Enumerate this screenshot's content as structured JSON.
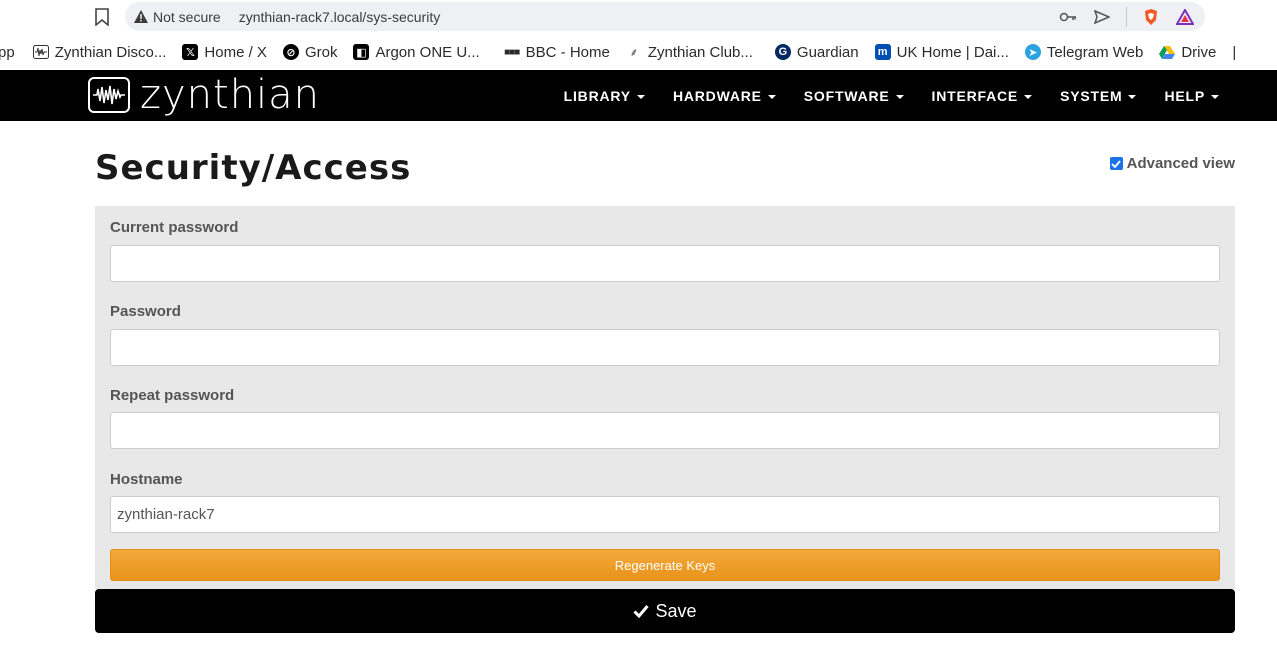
{
  "browser": {
    "security_label": "Not secure",
    "url": "zynthian-rack7.local/sys-security",
    "bookmarks": [
      {
        "label": "pp",
        "icon": "app-icon"
      },
      {
        "label": "Zynthian Disco...",
        "icon": "zynthian-icon"
      },
      {
        "label": "Home / X",
        "icon": "x-icon"
      },
      {
        "label": "Grok",
        "icon": "grok-icon"
      },
      {
        "label": "Argon ONE U...",
        "icon": "argon-icon"
      },
      {
        "label": "BBC - Home",
        "icon": "bbc-icon"
      },
      {
        "label": "Zynthian Club...",
        "icon": "zynthian-club-icon"
      },
      {
        "label": "Guardian",
        "icon": "guardian-icon"
      },
      {
        "label": "UK Home | Dai...",
        "icon": "dailymail-icon"
      },
      {
        "label": "Telegram Web",
        "icon": "telegram-icon"
      },
      {
        "label": "Drive",
        "icon": "drive-icon"
      }
    ]
  },
  "navbar": {
    "logo_text": "zynthian",
    "items": [
      {
        "label": "LIBRARY"
      },
      {
        "label": "HARDWARE"
      },
      {
        "label": "SOFTWARE"
      },
      {
        "label": "INTERFACE"
      },
      {
        "label": "SYSTEM"
      },
      {
        "label": "HELP"
      }
    ]
  },
  "page": {
    "title": "Security/Access",
    "advanced_view_label": "Advanced view",
    "advanced_view_checked": true
  },
  "form": {
    "current_password": {
      "label": "Current password",
      "value": ""
    },
    "password": {
      "label": "Password",
      "value": ""
    },
    "repeat_password": {
      "label": "Repeat password",
      "value": ""
    },
    "hostname": {
      "label": "Hostname",
      "value": "zynthian-rack7"
    },
    "regenerate_label": "Regenerate Keys",
    "save_label": "Save"
  },
  "colors": {
    "navbar_bg": "#000000",
    "regen_button": "#f0a030",
    "save_button": "#000000",
    "panel_bg": "#e8e8e8"
  }
}
